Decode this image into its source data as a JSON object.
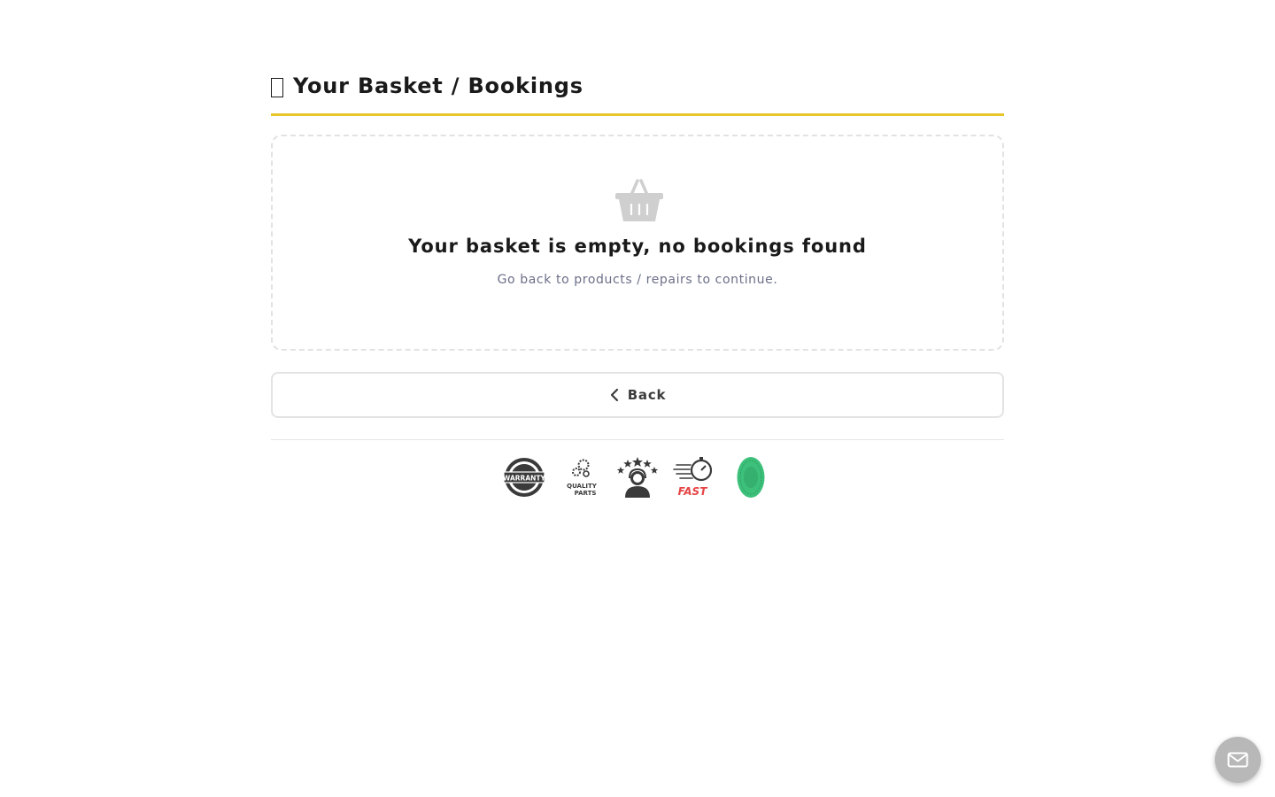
{
  "header": {
    "title": "Your Basket / Bookings",
    "accent_color": "#e8c52a"
  },
  "empty_state": {
    "icon": "basket-icon",
    "title": "Your basket is empty, no bookings found",
    "subtitle": "Go back to products / repairs to continue."
  },
  "back_button": {
    "icon": "chevron-left-icon",
    "label": "Back"
  },
  "badges": [
    {
      "icon": "warranty-badge-icon",
      "text": "WARRANTY"
    },
    {
      "icon": "quality-parts-badge-icon",
      "text": "QUALITY PARTS"
    },
    {
      "icon": "five-star-support-badge-icon"
    },
    {
      "icon": "fast-service-badge-icon",
      "text": "FAST"
    },
    {
      "icon": "green-seal-badge-icon"
    }
  ],
  "contact_fab": {
    "icon": "envelope-icon"
  }
}
